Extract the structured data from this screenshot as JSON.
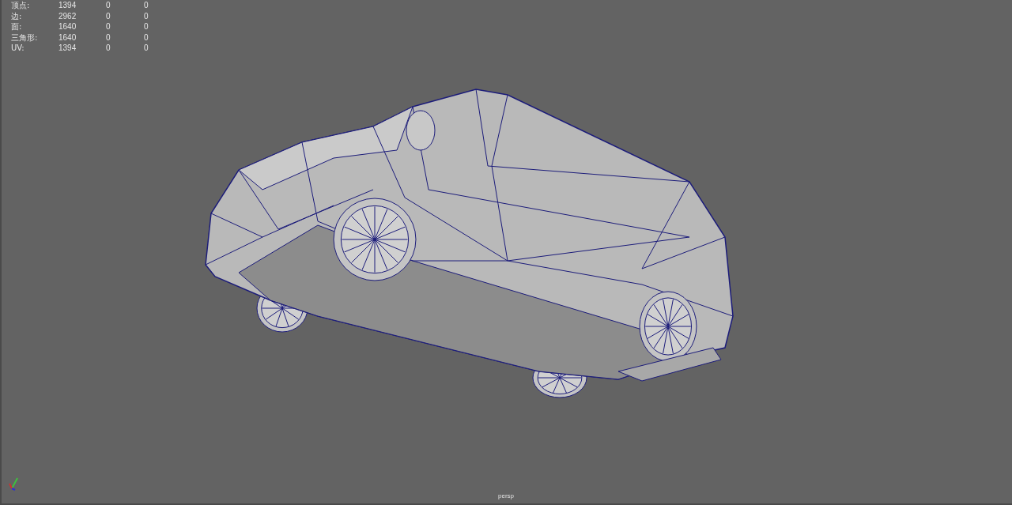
{
  "heads_up_display": {
    "rows": [
      {
        "label": "顶点:",
        "values": [
          "1394",
          "0",
          "0"
        ]
      },
      {
        "label": "边:",
        "values": [
          "2962",
          "0",
          "0"
        ]
      },
      {
        "label": "面:",
        "values": [
          "1640",
          "0",
          "0"
        ]
      },
      {
        "label": "三角形:",
        "values": [
          "1640",
          "0",
          "0"
        ]
      },
      {
        "label": "UV:",
        "values": [
          "1394",
          "0",
          "0"
        ]
      }
    ]
  },
  "viewport": {
    "camera_label": "persp"
  }
}
